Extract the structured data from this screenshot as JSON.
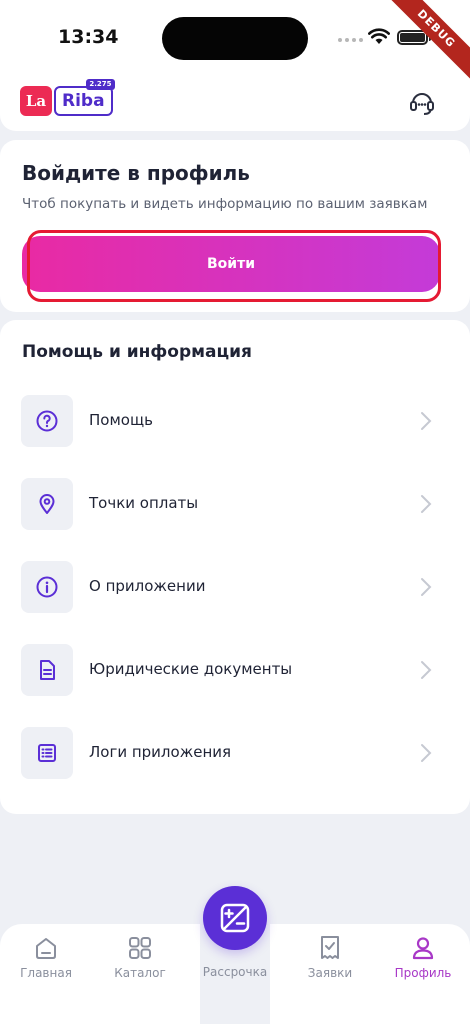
{
  "status_bar": {
    "time": "13:34",
    "debug_label": "DEBUG"
  },
  "header": {
    "logo_mark": "La",
    "logo_word": "Riba",
    "logo_version": "2.275",
    "support_icon": "headset-icon"
  },
  "login_card": {
    "title": "Войдите в профиль",
    "subtitle": "Чтоб покупать и видеть информацию по вашим заявкам",
    "button_label": "Войти"
  },
  "help_section": {
    "title": "Помощь и информация",
    "items": [
      {
        "label": "Помощь",
        "icon": "question-circle-icon"
      },
      {
        "label": "Точки оплаты",
        "icon": "map-pin-icon"
      },
      {
        "label": "О приложении",
        "icon": "info-circle-icon"
      },
      {
        "label": "Юридические документы",
        "icon": "document-icon"
      },
      {
        "label": "Логи приложения",
        "icon": "list-icon"
      }
    ]
  },
  "bottom_nav": {
    "items": [
      {
        "label": "Главная",
        "icon": "home-icon",
        "active": false
      },
      {
        "label": "Каталог",
        "icon": "grid-icon",
        "active": false
      },
      {
        "label": "Рассрочка",
        "icon": "plus-minus-icon",
        "active": false
      },
      {
        "label": "Заявки",
        "icon": "receipt-icon",
        "active": false
      },
      {
        "label": "Профиль",
        "icon": "user-icon",
        "active": true
      }
    ]
  },
  "colors": {
    "accent": "#5b2fd6",
    "button_gradient_start": "#e92aa3",
    "button_gradient_end": "#c43bd8",
    "active_tab": "#a838c7",
    "highlight": "#e51a33"
  }
}
